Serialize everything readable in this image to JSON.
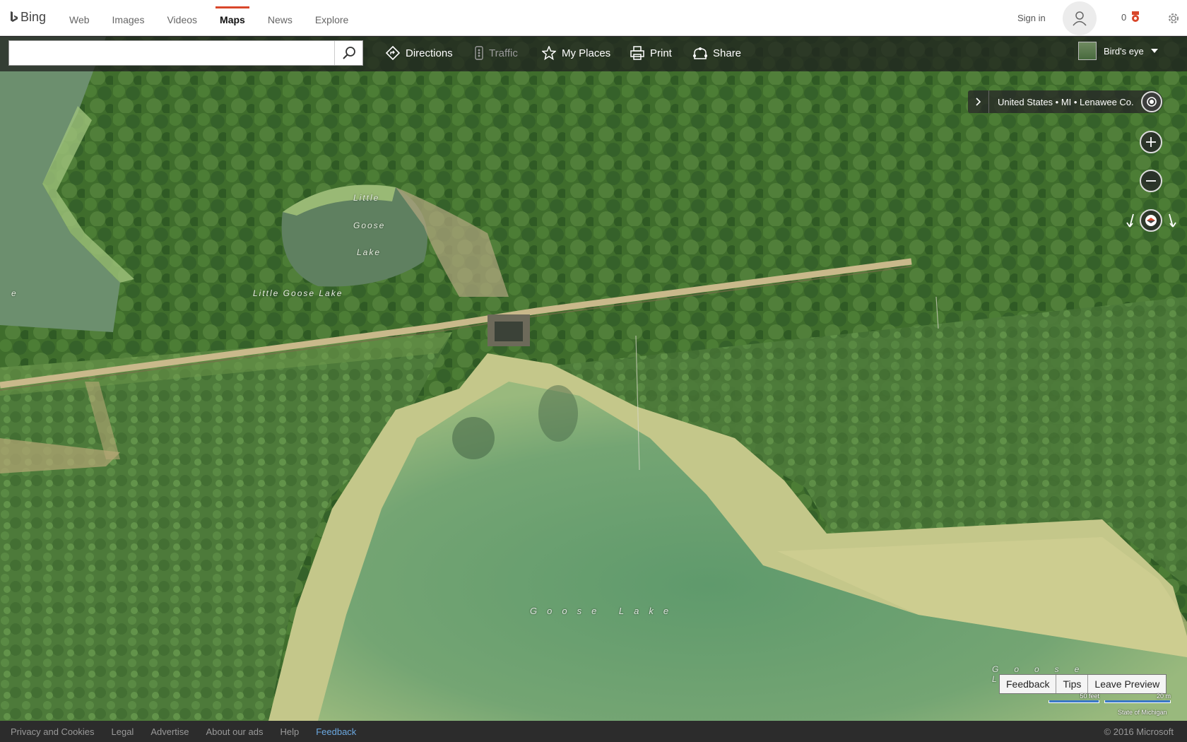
{
  "header": {
    "logo_text": "Bing",
    "nav": [
      {
        "label": "Web",
        "active": false
      },
      {
        "label": "Images",
        "active": false
      },
      {
        "label": "Videos",
        "active": false
      },
      {
        "label": "Maps",
        "active": true
      },
      {
        "label": "News",
        "active": false
      },
      {
        "label": "Explore",
        "active": false
      }
    ],
    "signin_label": "Sign in",
    "rewards_count": "0",
    "accent_color": "#d9472b"
  },
  "toolbar": {
    "search_value": "",
    "directions_label": "Directions",
    "traffic_label": "Traffic",
    "my_places_label": "My Places",
    "print_label": "Print",
    "share_label": "Share",
    "map_style_label": "Bird's eye"
  },
  "map": {
    "breadcrumb": "United States • MI • Lenawee Co.",
    "labels": {
      "little_lake_1": "Little",
      "little_lake_2": "Goose",
      "little_lake_3": "Lake",
      "little_goose_lake": "Little Goose Lake",
      "edge_letter": "e",
      "goose_lake": "Goose Lake",
      "goose_lake_bottom": "Goose Lake"
    },
    "feedback_label": "Feedback",
    "tips_label": "Tips",
    "leave_preview_label": "Leave Preview",
    "scale_feet": "50 feet",
    "scale_m": "20 m",
    "map_copyright": "State of Michigan"
  },
  "footer": {
    "links": [
      "Privacy and Cookies",
      "Legal",
      "Advertise",
      "About our ads",
      "Help",
      "Feedback"
    ],
    "copyright": "© 2016 Microsoft"
  }
}
